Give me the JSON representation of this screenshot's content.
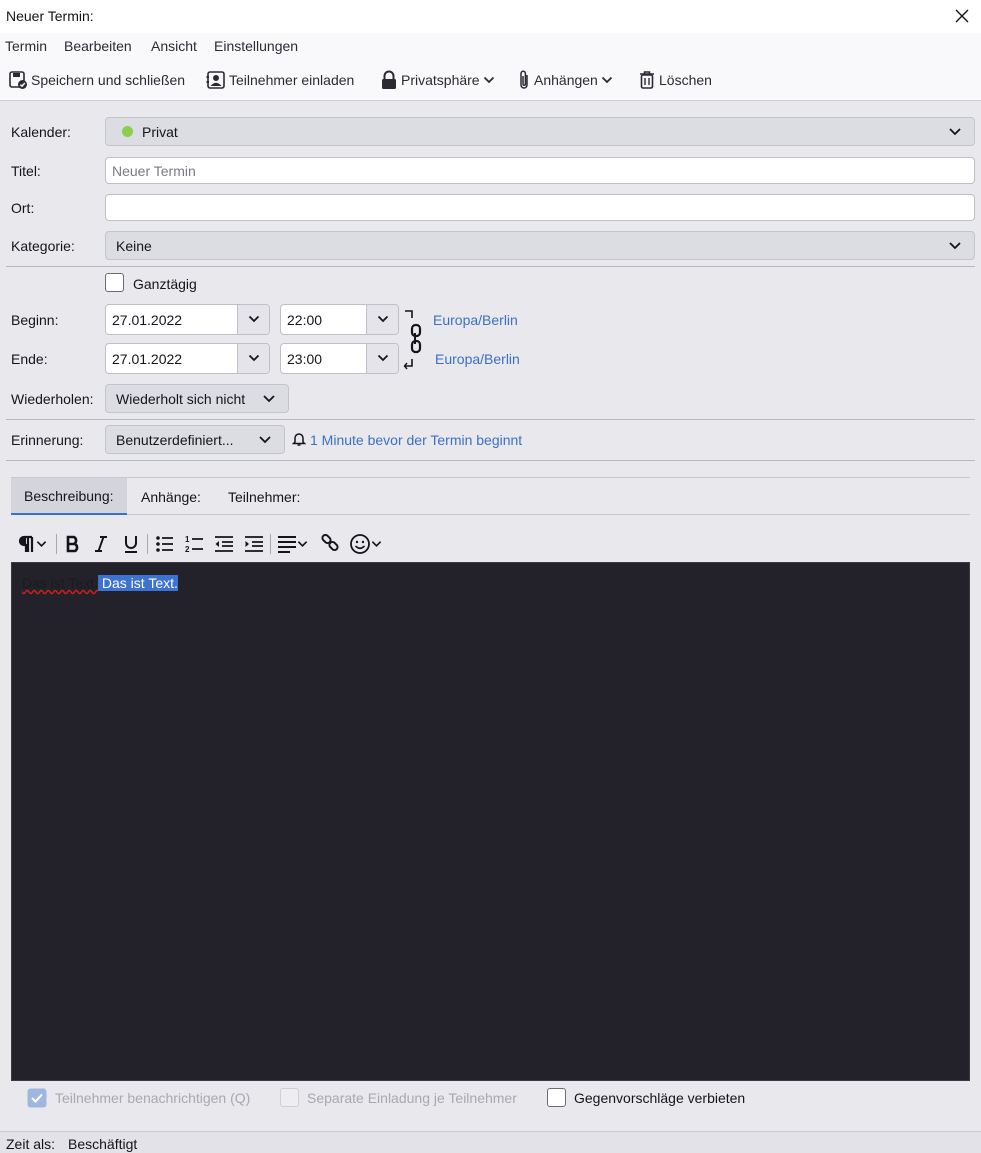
{
  "window": {
    "title": "Neuer Termin:"
  },
  "menu": {
    "items": [
      "Termin",
      "Bearbeiten",
      "Ansicht",
      "Einstellungen"
    ]
  },
  "toolbar": {
    "save_close": "Speichern und schließen",
    "invite": "Teilnehmer einladen",
    "privacy": "Privatsphäre",
    "attach": "Anhängen",
    "delete": "Löschen"
  },
  "form": {
    "calendar_label": "Kalender:",
    "calendar_value": "Privat",
    "calendar_color": "#8bcf4e",
    "title_label": "Titel:",
    "title_placeholder": "Neuer Termin",
    "title_value": "",
    "location_label": "Ort:",
    "location_value": "",
    "category_label": "Kategorie:",
    "category_value": "Keine",
    "allday_label": "Ganztägig",
    "allday_checked": false,
    "start_label": "Beginn:",
    "start_date": "27.01.2022",
    "start_time": "22:00",
    "start_timezone": "Europa/Berlin",
    "end_label": "Ende:",
    "end_date": "27.01.2022",
    "end_time": "23:00",
    "end_timezone": "Europa/Berlin",
    "repeat_label": "Wiederholen:",
    "repeat_value": "Wiederholt sich nicht",
    "reminder_label": "Erinnerung:",
    "reminder_value": "Benutzerdefiniert...",
    "reminder_detail": "1 Minute bevor der Termin beginnt"
  },
  "tabs": [
    "Beschreibung:",
    "Anhänge:",
    "Teilnehmer:"
  ],
  "editor": {
    "text_plain": "Das ist Text.",
    "text_selected": " Das ist Text."
  },
  "options": {
    "notify_label": "Teilnehmer benachrichtigen (Q)",
    "notify_checked": true,
    "separate_label": "Separate Einladung je Teilnehmer",
    "separate_checked": false,
    "no_counter_label": "Gegenvorschläge verbieten",
    "no_counter_checked": false
  },
  "status": {
    "show_time_as_label": "Zeit als:",
    "show_time_as_value": "Beschäftigt"
  },
  "colors": {
    "accent": "#3d6fc4",
    "selection": "#3c73d0",
    "editor_bg": "#23222b"
  }
}
